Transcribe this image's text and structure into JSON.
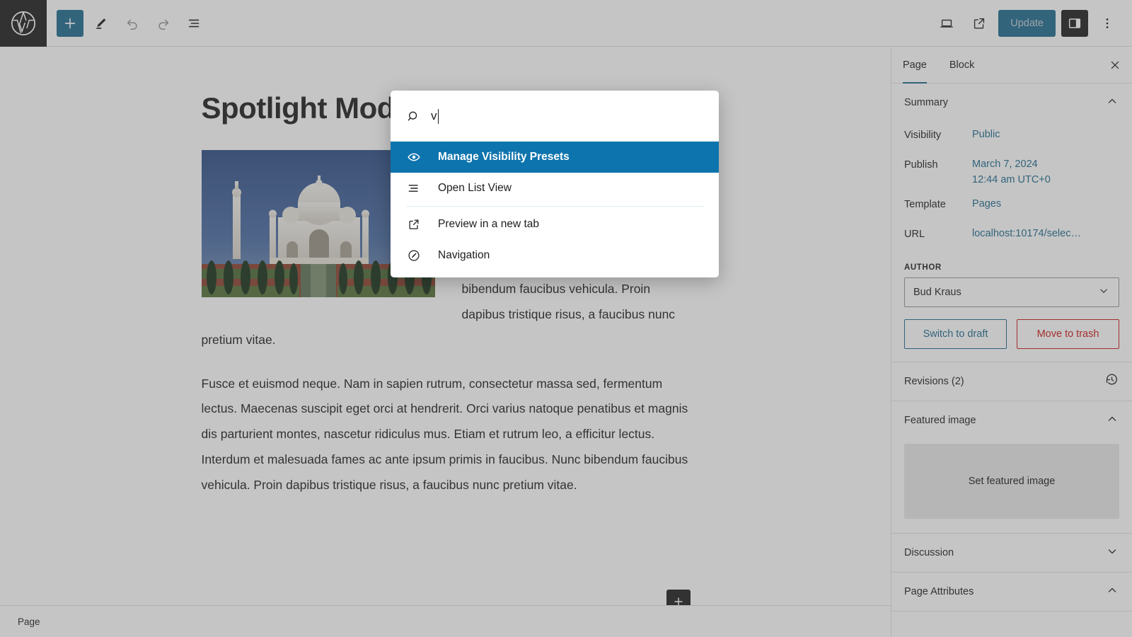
{
  "toolbar": {
    "logo_icon": "wordpress-logo-icon",
    "left_buttons": [
      {
        "name": "block-inserter-toggle",
        "icon": "plus-icon",
        "label": "Toggle block inserter",
        "state": "active"
      },
      {
        "name": "tools-edit",
        "icon": "pencil-icon",
        "label": "Tools"
      },
      {
        "name": "undo",
        "icon": "undo-arrow-icon",
        "label": "Undo",
        "state": "disabled"
      },
      {
        "name": "redo",
        "icon": "redo-arrow-icon",
        "label": "Redo",
        "state": "disabled"
      },
      {
        "name": "list-view",
        "icon": "list-view-icon",
        "label": "Document Overview"
      }
    ],
    "right_buttons": [
      {
        "name": "view-device",
        "icon": "laptop-icon",
        "label": "View"
      },
      {
        "name": "preview-external",
        "icon": "external-link-icon",
        "label": "Preview in new tab"
      }
    ],
    "update_label": "Update",
    "settings_sidebar_label": "Settings",
    "settings_sidebar_icon": "sidebar-panel-icon",
    "options_label": "Options",
    "options_icon": "three-dots-vertical-icon",
    "accent_blue": "#1e6a8e",
    "dark": "#1e1e1e"
  },
  "editor": {
    "title": "Spotlight Mode",
    "image_alt": "Taj Mahal with reflecting pool",
    "paragraph_1": "Orci varius natoque penatibus et magnis dis parturient montes, nascetur ridiculus mus. Etiam et rutrum leo, a efficitur lectus. Interdum et malesuada fames ac ante ipsum primis in faucibus. Nunc bibendum faucibus vehicula. Proin dapibus tristique risus, a faucibus nunc pretium vitae.",
    "paragraph_2": "Fusce et euismod neque. Nam in sapien rutrum, consectetur massa sed, fermentum lectus. Maecenas suscipit eget orci at hendrerit. Orci varius natoque penatibus et magnis dis parturient montes, nascetur ridiculus mus. Etiam et rutrum leo, a efficitur lectus. Interdum et malesuada fames ac ante ipsum primis in faucibus. Nunc bibendum faucibus vehicula. Proin dapibus tristique risus, a faucibus nunc pretium vitae.",
    "inserter_icon": "plus-icon",
    "breadcrumb": "Page"
  },
  "command_palette": {
    "search_value": "v",
    "search_icon": "search-icon",
    "items": [
      {
        "label": "Manage Visibility Presets",
        "icon": "eye-icon",
        "selected": true
      },
      {
        "label": "Open List View",
        "icon": "list-view-icon",
        "selected": false
      },
      {
        "label": "Preview in a new tab",
        "icon": "external-link-icon",
        "selected": false
      },
      {
        "label": "Navigation",
        "icon": "compass-icon",
        "selected": false
      }
    ],
    "separator_after_index": 1,
    "highlight_color": "#0e74ad"
  },
  "sidebar": {
    "tabs": [
      {
        "label": "Page",
        "active": true
      },
      {
        "label": "Block",
        "active": false
      }
    ],
    "close_icon": "close-icon",
    "summary": {
      "title": "Summary",
      "chevron": "chevron-up-icon",
      "rows": [
        {
          "label": "Visibility",
          "value": "Public",
          "value2": ""
        },
        {
          "label": "Publish",
          "value": "March 7, 2024",
          "value2": "12:44 am UTC+0"
        },
        {
          "label": "Template",
          "value": "Pages",
          "value2": ""
        },
        {
          "label": "URL",
          "value": "localhost:10174/selec…",
          "value2": ""
        }
      ],
      "author_label": "AUTHOR",
      "author_value": "Bud Kraus",
      "author_chevron": "chevron-down-icon",
      "switch_to_draft": "Switch to draft",
      "move_to_trash": "Move to trash"
    },
    "revisions": {
      "title": "Revisions (2)",
      "icon": "revision-history-icon"
    },
    "featured_image": {
      "title": "Featured image",
      "chevron": "chevron-up-icon",
      "placeholder": "Set featured image"
    },
    "discussion": {
      "title": "Discussion",
      "chevron": "chevron-down-icon"
    },
    "page_attributes": {
      "title": "Page Attributes",
      "chevron": "chevron-up-icon"
    }
  }
}
